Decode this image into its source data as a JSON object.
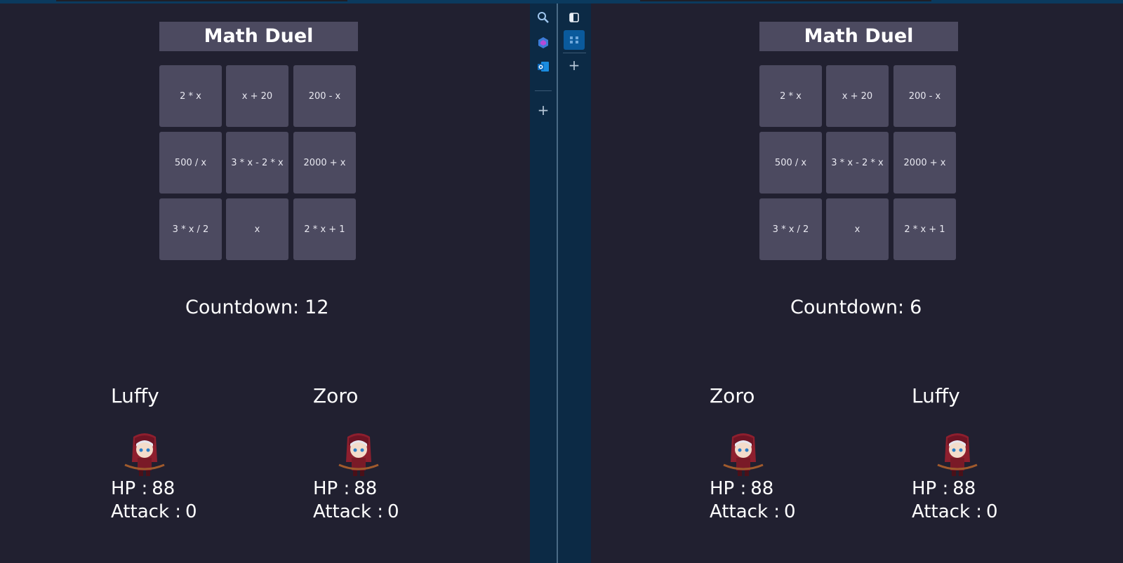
{
  "panels": [
    {
      "title": "Math Duel",
      "cards": [
        "2 * x",
        "x + 20",
        "200 - x",
        "500 / x",
        "3 * x - 2 * x",
        "2000 + x",
        "3 * x / 2",
        "x",
        "2 * x + 1"
      ],
      "countdown_label": "Countdown:",
      "countdown_value": "12",
      "players": [
        {
          "name": "Luffy",
          "hp_label": "HP :",
          "hp": "88",
          "attack_label": "Attack :",
          "attack": "0"
        },
        {
          "name": "Zoro",
          "hp_label": "HP :",
          "hp": "88",
          "attack_label": "Attack :",
          "attack": "0"
        }
      ]
    },
    {
      "title": "Math Duel",
      "cards": [
        "2 * x",
        "x + 20",
        "200 - x",
        "500 / x",
        "3 * x - 2 * x",
        "2000 + x",
        "3 * x / 2",
        "x",
        "2 * x + 1"
      ],
      "countdown_label": "Countdown:",
      "countdown_value": "6",
      "players": [
        {
          "name": "Zoro",
          "hp_label": "HP :",
          "hp": "88",
          "attack_label": "Attack :",
          "attack": "0"
        },
        {
          "name": "Luffy",
          "hp_label": "HP :",
          "hp": "88",
          "attack_label": "Attack :",
          "attack": "0"
        }
      ]
    }
  ],
  "sidebar": {
    "icons": [
      "search-icon",
      "copilot-icon",
      "outlook-icon",
      "add-icon"
    ],
    "workspace_icons": [
      "tab-actions-icon",
      "split-view-icon",
      "add-icon"
    ],
    "plus_symbol": "+"
  },
  "colors": {
    "panel_bg": "#212030",
    "tile_bg": "#4c4a60",
    "sidebar_bg": "#0c2a45",
    "cloak_red": "#8e1f2e",
    "accent_blue": "#0a5a9c"
  }
}
